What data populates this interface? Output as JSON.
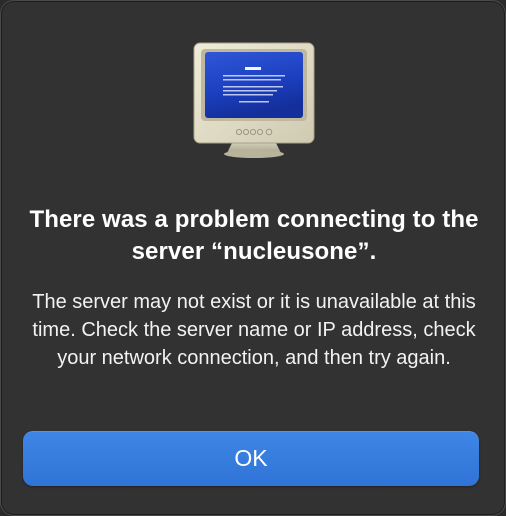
{
  "dialog": {
    "icon": "crt-monitor-icon",
    "title": "There was a problem connecting to the server “nucleusone”.",
    "message": "The server may not exist or it is unavailable at this time. Check the server name or IP address, check your network connection, and then try again.",
    "ok_label": "OK"
  },
  "colors": {
    "background": "#323232",
    "accent": "#3179dc",
    "text": "#ffffff"
  }
}
